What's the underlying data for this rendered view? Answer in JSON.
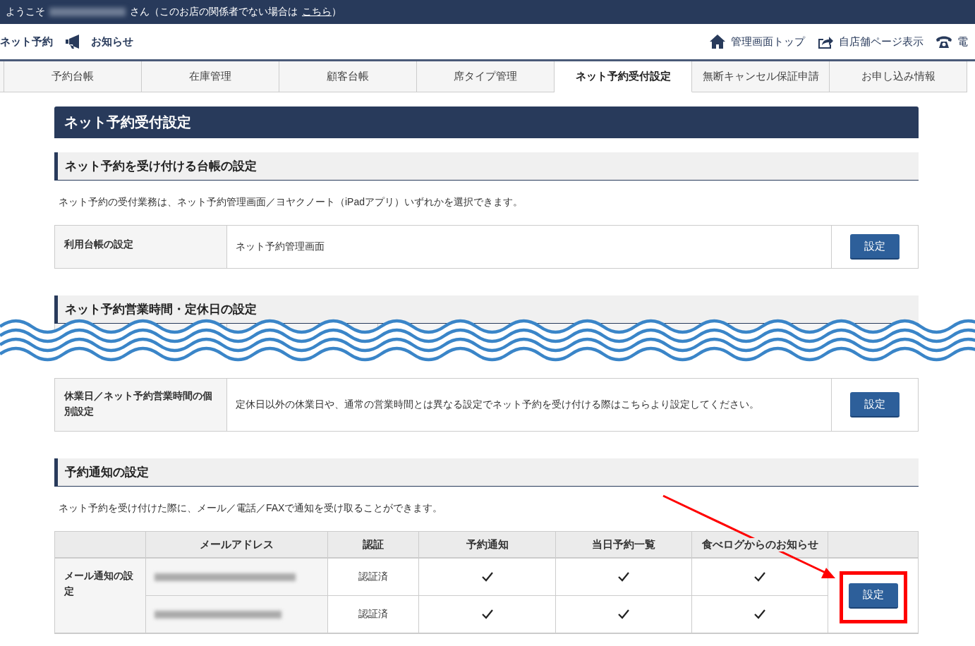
{
  "top_bar": {
    "greeting": "ようこそ",
    "suffix": "さん（このお店の関係者でない場合は",
    "link": "こちら",
    "closing": "）"
  },
  "header": {
    "service_name": "ネット予約",
    "news": "お知らせ",
    "links": [
      {
        "kind": "home",
        "label": "管理画面トップ"
      },
      {
        "kind": "share",
        "label": "自店舗ページ表示"
      },
      {
        "kind": "phone",
        "label": "電"
      }
    ]
  },
  "tabs": [
    {
      "label": "予約台帳",
      "selected": false
    },
    {
      "label": "在庫管理",
      "selected": false
    },
    {
      "label": "顧客台帳",
      "selected": false
    },
    {
      "label": "席タイプ管理",
      "selected": false
    },
    {
      "label": "ネット予約受付設定",
      "selected": true
    },
    {
      "label": "無断キャンセル保証申請",
      "selected": false
    },
    {
      "label": "お申し込み情報",
      "selected": false
    }
  ],
  "page_title": "ネット予約受付設定",
  "ledger_section": {
    "heading": "ネット予約を受け付ける台帳の設定",
    "description": "ネット予約の受付業務は、ネット予約管理画面／ヨヤクノート（iPadアプリ）いずれかを選択できます。",
    "row": {
      "label": "利用台帳の設定",
      "value": "ネット予約管理画面",
      "button": "設定"
    }
  },
  "hours_section": {
    "heading": "ネット予約営業時間・定休日の設定",
    "row": {
      "label": "休業日／ネット予約営業時間の個別設定",
      "value": "定休日以外の休業日や、通常の営業時間とは異なる設定でネット予約を受け付ける際はこちらより設定してください。",
      "button": "設定"
    }
  },
  "notify_section": {
    "heading": "予約通知の設定",
    "description": "ネット予約を受け付けた際に、メール／電話／FAXで通知を受け取ることができます。",
    "columns": [
      "メールアドレス",
      "認証",
      "予約通知",
      "当日予約一覧",
      "食べログからのお知らせ"
    ],
    "row_label": "メール通知の設定",
    "button": "設定",
    "rows": [
      {
        "status": "認証済",
        "checks": [
          true,
          true,
          true
        ]
      },
      {
        "status": "認証済",
        "checks": [
          true,
          true,
          true
        ]
      }
    ]
  }
}
